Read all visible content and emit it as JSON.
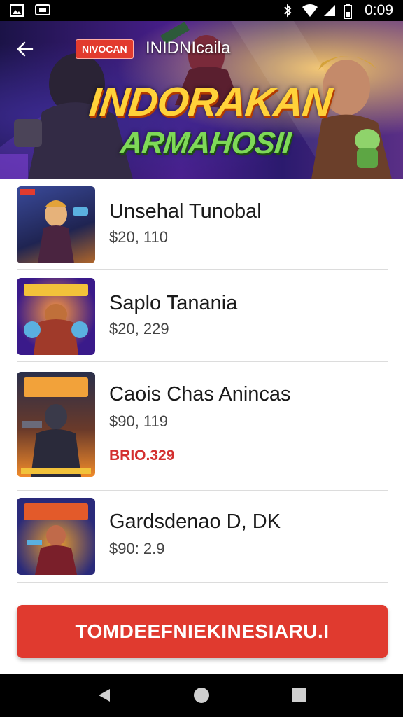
{
  "status_bar": {
    "time": "0:09",
    "icons": [
      "gallery-icon",
      "message-icon",
      "bluetooth-icon",
      "wifi-icon",
      "cellular-icon",
      "battery-icon"
    ]
  },
  "banner": {
    "back_icon": "arrow-left-icon",
    "tag": "NIVOCAN",
    "subtitle": "INIDNIcaila",
    "title_line1": "INDORAKAN",
    "title_line2": "ARMAHOSII"
  },
  "items": [
    {
      "name": "Unsehal Tunobal",
      "price": "$20, 110"
    },
    {
      "name": "Saplo Tanania",
      "price": "$20, 229"
    },
    {
      "name": "Caois Chas Anincas",
      "price": "$90, 119",
      "sale": "BRIO.329"
    },
    {
      "name": "Gardsdenao D, DK",
      "price": "$90: 2.9"
    }
  ],
  "cta": {
    "label": "TOMDEEFNIEKINESIARU.I"
  },
  "nav_bar": {
    "icons": [
      "back-triangle-icon",
      "home-circle-icon",
      "recents-square-icon"
    ]
  },
  "colors": {
    "accent": "#e03a2f",
    "status_bar": "#000000",
    "sale_text": "#d32f2f"
  }
}
